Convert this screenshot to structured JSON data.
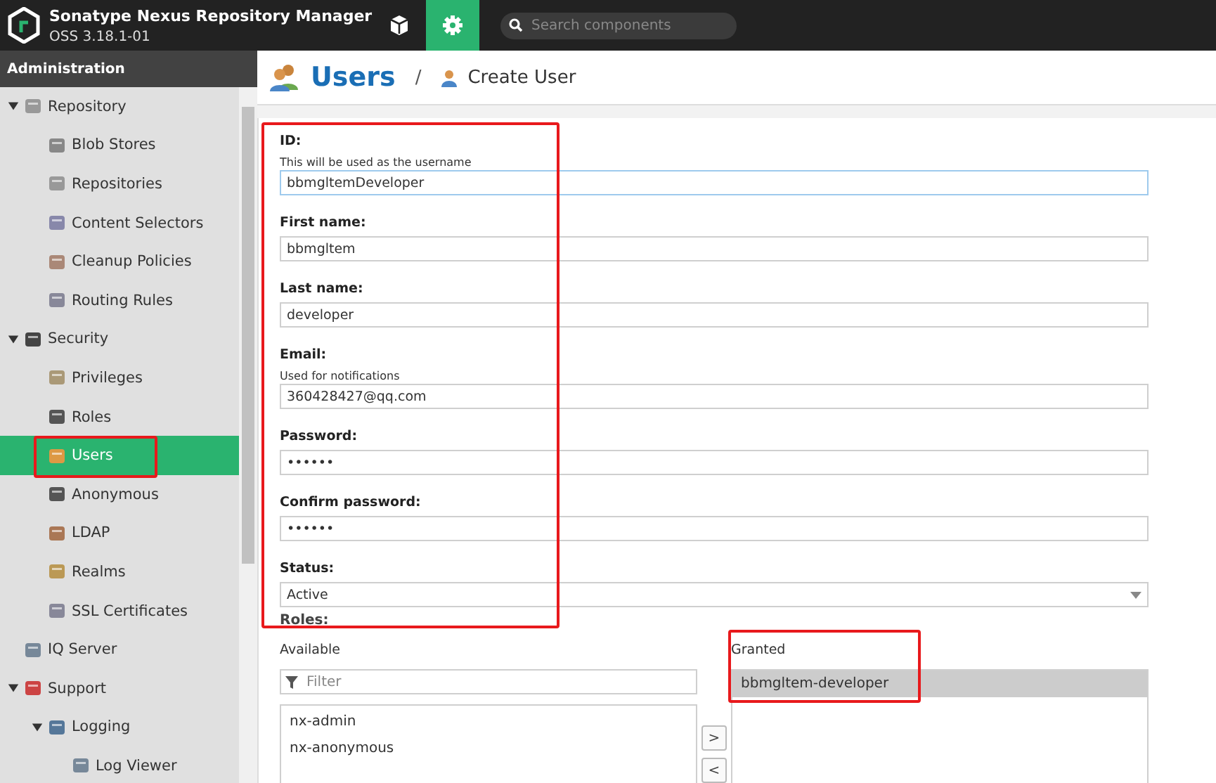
{
  "header": {
    "title": "Sonatype Nexus Repository Manager",
    "version": "OSS 3.18.1-01",
    "modes": [
      {
        "selected": false
      },
      {
        "selected": true
      }
    ],
    "search": {
      "placeholder": "Search components"
    }
  },
  "sidebar": {
    "title": "Administration",
    "items": [
      {
        "label": "Repository",
        "expanded": true,
        "selected": false,
        "highlighted": false,
        "children": [
          {
            "label": "Blob Stores",
            "selected": false,
            "highlighted": false
          },
          {
            "label": "Repositories",
            "selected": false,
            "highlighted": false
          },
          {
            "label": "Content Selectors",
            "selected": false,
            "highlighted": false
          },
          {
            "label": "Cleanup Policies",
            "selected": false,
            "highlighted": false
          },
          {
            "label": "Routing Rules",
            "selected": false,
            "highlighted": false
          }
        ]
      },
      {
        "label": "Security",
        "expanded": true,
        "selected": false,
        "highlighted": false,
        "children": [
          {
            "label": "Privileges",
            "selected": false,
            "highlighted": false
          },
          {
            "label": "Roles",
            "selected": false,
            "highlighted": false
          },
          {
            "label": "Users",
            "selected": true,
            "highlighted": true
          },
          {
            "label": "Anonymous",
            "selected": false,
            "highlighted": false
          },
          {
            "label": "LDAP",
            "selected": false,
            "highlighted": false
          },
          {
            "label": "Realms",
            "selected": false,
            "highlighted": false
          },
          {
            "label": "SSL Certificates",
            "selected": false,
            "highlighted": false
          }
        ]
      },
      {
        "label": "IQ Server",
        "selected": false,
        "highlighted": false
      },
      {
        "label": "Support",
        "expanded": true,
        "selected": false,
        "highlighted": false,
        "children": [
          {
            "label": "Logging",
            "expanded": true,
            "selected": false,
            "highlighted": false,
            "children": [
              {
                "label": "Log Viewer",
                "selected": false,
                "highlighted": false
              }
            ]
          }
        ]
      }
    ]
  },
  "breadcrumb": {
    "title": "Users",
    "separator": "/",
    "current": "Create User"
  },
  "form": {
    "highlighted": true,
    "fields": [
      {
        "label": "ID:",
        "hint": "This will be used as the username",
        "value": "bbmgltemDeveloper",
        "kind": "text",
        "focused": true
      },
      {
        "label": "First name:",
        "value": "bbmgltem",
        "kind": "text",
        "focused": false
      },
      {
        "label": "Last name:",
        "value": "developer",
        "kind": "text",
        "focused": false
      },
      {
        "label": "Email:",
        "hint": "Used for notifications",
        "value": "360428427@qq.com",
        "kind": "text",
        "focused": false
      },
      {
        "label": "Password:",
        "value": "••••••",
        "kind": "text",
        "focused": false
      },
      {
        "label": "Confirm password:",
        "value": "••••••",
        "kind": "text",
        "focused": false
      },
      {
        "label": "Status:",
        "value": "Active",
        "kind": "select",
        "focused": false
      }
    ]
  },
  "roles": {
    "label": "Roles:",
    "available": {
      "label": "Available",
      "filter_placeholder": "Filter",
      "items": [
        {
          "label": "nx-admin",
          "selected": false
        },
        {
          "label": "nx-anonymous",
          "selected": false
        }
      ]
    },
    "buttons": [
      ">",
      "<"
    ],
    "granted": {
      "label": "Granted",
      "highlighted": true,
      "items": [
        {
          "label": "bbmgltem-developer",
          "selected": true
        }
      ]
    }
  }
}
